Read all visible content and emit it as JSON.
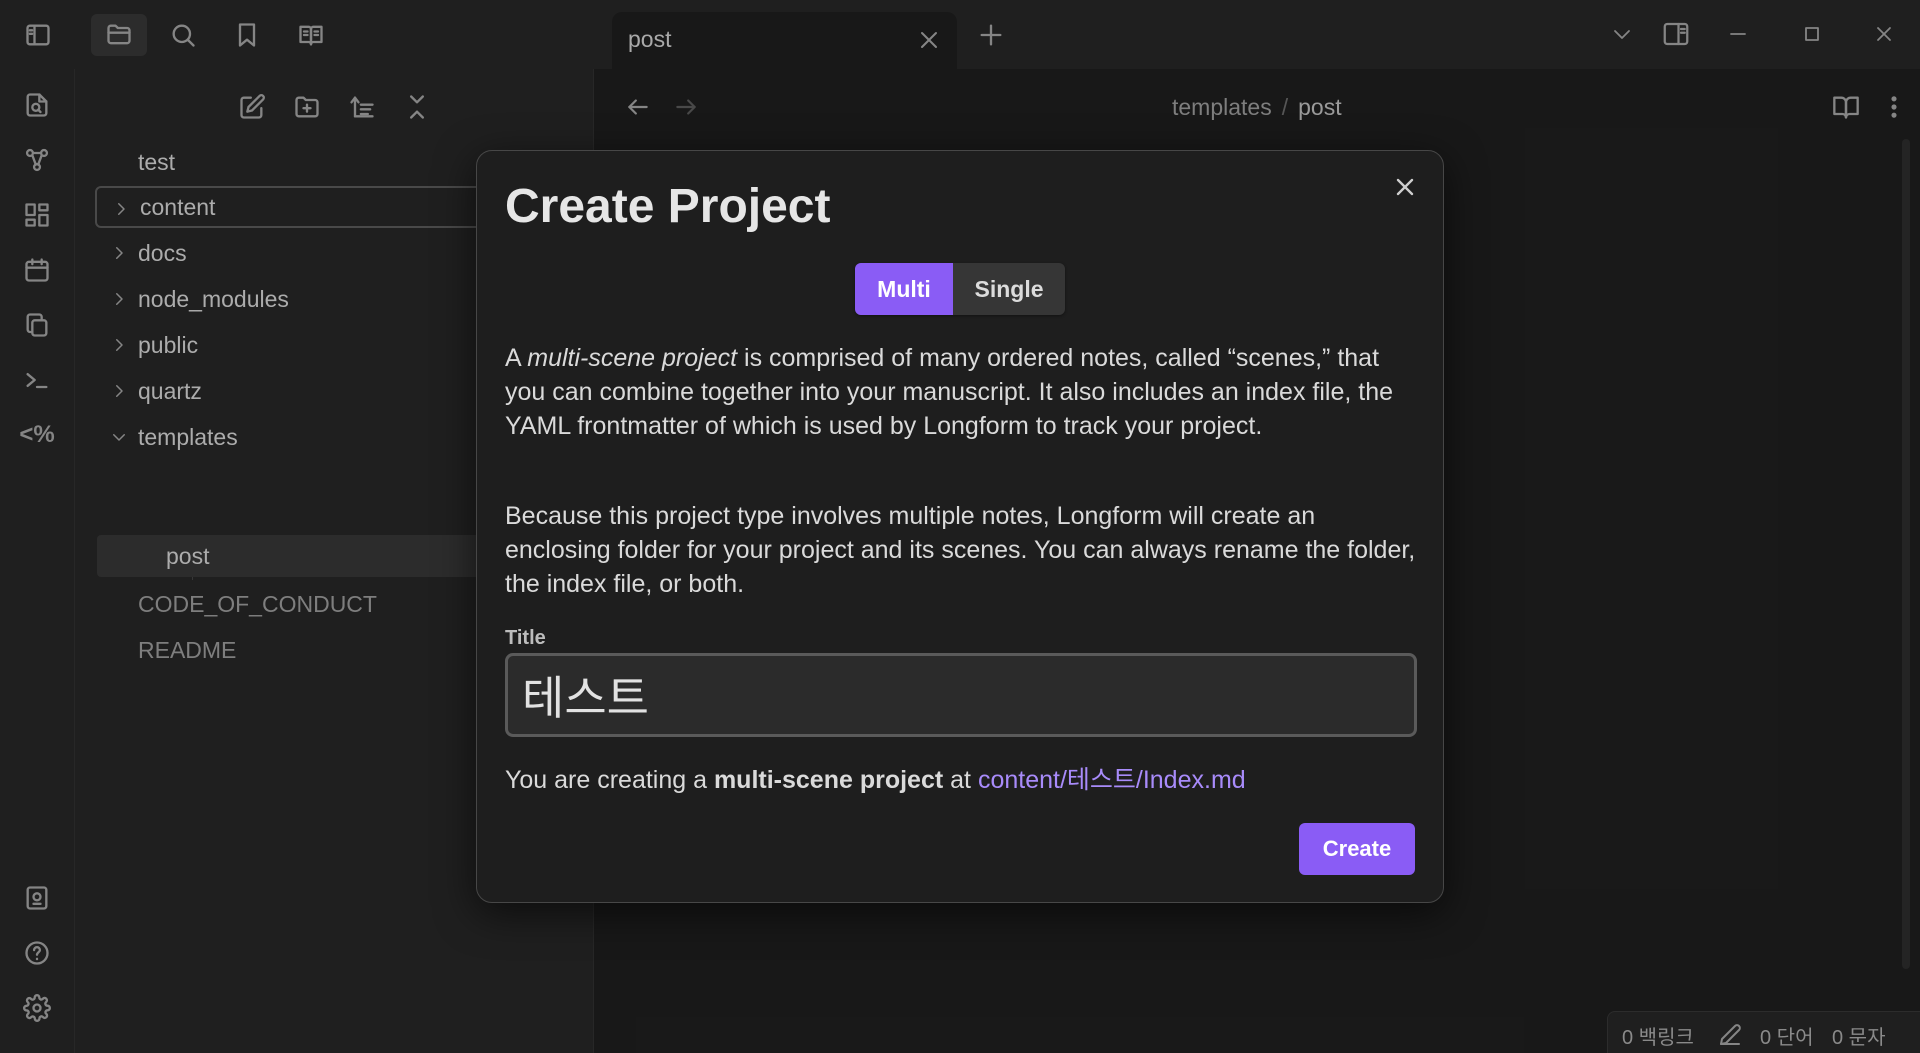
{
  "titlebar": {
    "tab_title": "post",
    "icons": [
      "sidebar-left-icon",
      "folder-icon",
      "search-icon",
      "bookmark-icon",
      "book-icon"
    ]
  },
  "ribbon": {
    "icons": [
      "open-quick-switcher-icon",
      "graph-icon",
      "canvas-icon",
      "calendar-icon",
      "copy-icon",
      "terminal-icon",
      "templater-icon",
      "vault-icon",
      "help-icon",
      "settings-icon"
    ],
    "templater_glyph": "<%"
  },
  "explorer": {
    "items": [
      {
        "label": "test",
        "type": "file",
        "state": "normal"
      },
      {
        "label": "content",
        "type": "folder",
        "state": "selected"
      },
      {
        "label": "docs",
        "type": "folder",
        "state": "normal"
      },
      {
        "label": "node_modules",
        "type": "folder",
        "state": "normal"
      },
      {
        "label": "public",
        "type": "folder",
        "state": "normal"
      },
      {
        "label": "quartz",
        "type": "folder",
        "state": "normal"
      },
      {
        "label": "templates",
        "type": "folder-open",
        "state": "normal"
      },
      {
        "label": "post",
        "type": "file",
        "state": "active"
      },
      {
        "label": "CODE_OF_CONDUCT",
        "type": "file",
        "state": "dim"
      },
      {
        "label": "README",
        "type": "file",
        "state": "dim"
      }
    ]
  },
  "editor": {
    "breadcrumb": {
      "parent": "templates",
      "separator": "/",
      "current": "post"
    }
  },
  "statusbar": {
    "backlinks": "0 백링크",
    "words": "0 단어",
    "chars": "0 문자"
  },
  "modal": {
    "title": "Create Project",
    "toggle": {
      "multi": "Multi",
      "single": "Single",
      "selected": "Multi"
    },
    "para1": {
      "pre": "A ",
      "em": "multi-scene project",
      "post": " is comprised of many ordered notes, called “scenes,” that you can combine together into your manuscript. It also includes an index file, the YAML frontmatter of which is used by Longform to track your project."
    },
    "para2": "Because this project type involves multiple notes, Longform will create an enclosing folder for your project and its scenes. You can always rename the folder, the index file, or both.",
    "field_label": "Title",
    "title_value": "테스트",
    "summary": {
      "pre": "You are creating a ",
      "bold": "multi-scene project",
      "mid": " at ",
      "path": "content/테스트/Index.md"
    },
    "create_label": "Create"
  },
  "colors": {
    "accent": "#8a5cf5",
    "link": "#a88bfa",
    "background": "#1e1e1e",
    "panel": "#262626"
  }
}
